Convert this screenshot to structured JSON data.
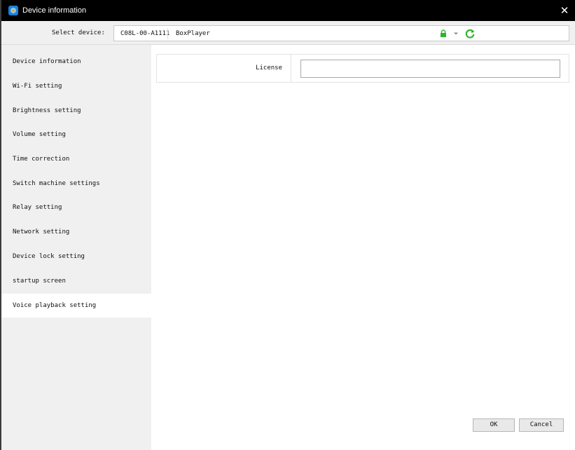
{
  "window": {
    "title": "Device information"
  },
  "select_device": {
    "label": "Select device:",
    "device_id": "C08L-00-A1111",
    "device_name": "BoxPlayer"
  },
  "sidebar": {
    "items": [
      {
        "label": "Device information"
      },
      {
        "label": "Wi-Fi setting"
      },
      {
        "label": "Brightness setting"
      },
      {
        "label": "Volume setting"
      },
      {
        "label": "Time correction"
      },
      {
        "label": "Switch machine settings"
      },
      {
        "label": "Relay setting"
      },
      {
        "label": "Network setting"
      },
      {
        "label": "Device lock setting"
      },
      {
        "label": "startup screen"
      },
      {
        "label": "Voice playback setting"
      }
    ],
    "selected": "Voice playback setting"
  },
  "form": {
    "license_label": "License",
    "license_value": ""
  },
  "buttons": {
    "ok": "OK",
    "cancel": "Cancel"
  },
  "colors": {
    "titlebar": "#000000",
    "sidebar_bg": "#f0f0f0",
    "lock_icon": "#2db52d",
    "refresh_icon": "#2db52d",
    "app_icon": "#1e7fd8"
  }
}
